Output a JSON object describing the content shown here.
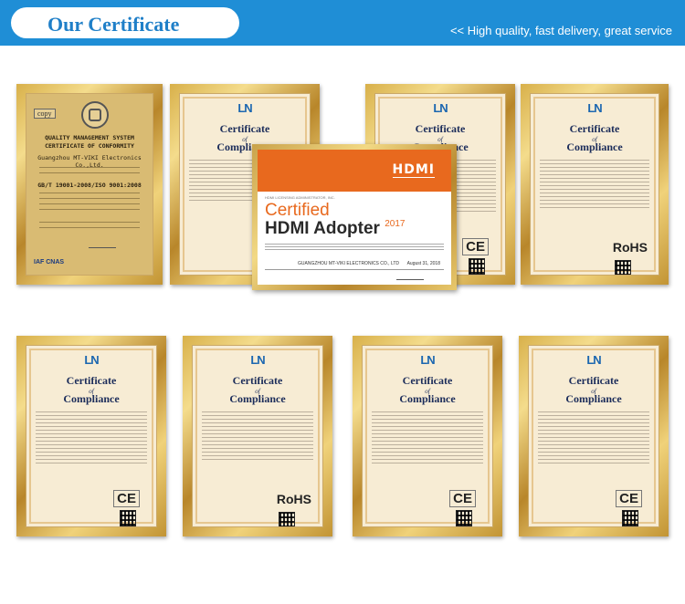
{
  "header": {
    "title": "Our Certificate",
    "tagline": "<< High quality, fast delivery, great service"
  },
  "certificates": {
    "qms": {
      "copy_label": "copy",
      "title_line1": "QUALITY MANAGEMENT SYSTEM",
      "title_line2": "CERTIFICATE OF CONFORMITY",
      "company": "Guangzhou MT-VIKI Electronics Co.,Ltd.",
      "standard": "GB/T 19001-2008/ISO 9001:2008",
      "logos": "IAF  CNAS"
    },
    "compliance": {
      "title": "Certificate",
      "of": "of",
      "subtitle": "Compliance",
      "brand": "LN"
    },
    "marks": {
      "ce": "CE",
      "rohs": "RoHS"
    },
    "hdmi": {
      "logo": "HDMI",
      "admin": "HDMI LICENSING ADMINISTRATOR, INC.",
      "certified": "Certified",
      "adopter": "HDMI Adopter",
      "year": "2017",
      "company": "GUANGZHOU MT-VIKI ELECTRONICS CO., LTD",
      "date": "August 31, 2018"
    }
  },
  "colors": {
    "header_blue": "#1f8ed6",
    "gold": "#d8b04a",
    "hdmi_orange": "#e8691e"
  }
}
